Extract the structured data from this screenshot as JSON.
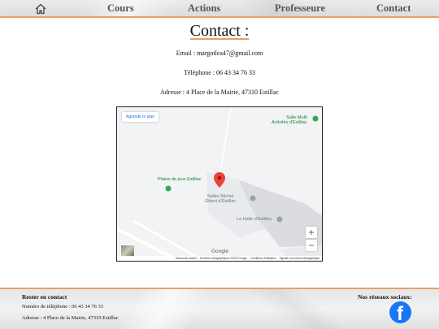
{
  "nav": {
    "home_icon": "home-icon",
    "items": [
      {
        "label": "Cours"
      },
      {
        "label": "Actions"
      },
      {
        "label": "Professeure"
      },
      {
        "label": "Contact"
      }
    ],
    "accent": "#e8a06a"
  },
  "main": {
    "title": "Contact :",
    "email": "Email : margotlea47@gmail.com",
    "phone": "Téléphone : 06 43 34 76 33",
    "address": "Adresse : 4 Place de la Mairie, 47310 Estillac"
  },
  "map": {
    "enlarge_button": "Agrandir le plan",
    "labels": {
      "salle_multi": "Salle Multi\nActivités d'Estillac",
      "plaine": "Plaine de jeux Estillac",
      "salles_michel": "Salles Michel\nGibert d'Estillac",
      "halle": "La Halle d'Estillac"
    },
    "zoom_in": "+",
    "zoom_out": "−",
    "logo": "Google",
    "footer": {
      "shortcuts": "Raccourcis clavier",
      "data": "Données cartographiques ©2022 Google",
      "terms": "Conditions d'utilisation",
      "report": "Signaler une erreur cartographique"
    },
    "marker_color": "#ea4335"
  },
  "footer": {
    "title": "Rester en contact",
    "phone": "Numéro de téléphone : 06 43 34 76 33",
    "address": "Adresse : 4 Place de la Mairie, 47310 Estillac",
    "social_title": "Nos réseaux sociaux:",
    "facebook_icon": "facebook-icon",
    "facebook_color": "#1877f2"
  }
}
